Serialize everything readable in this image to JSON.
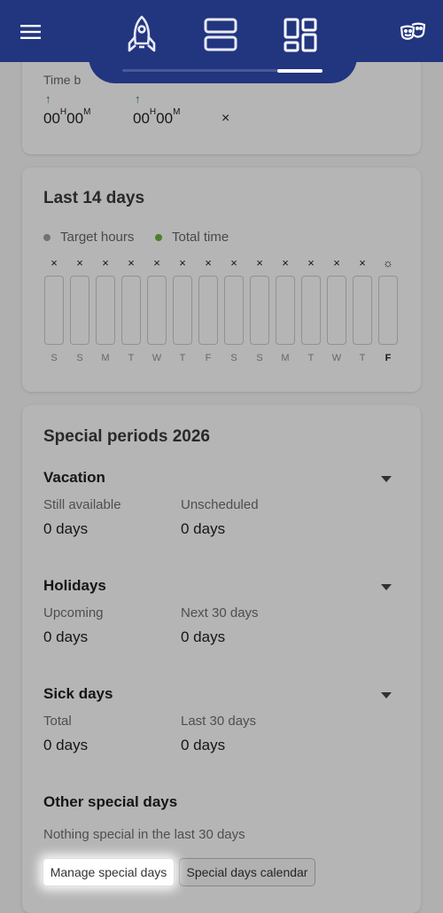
{
  "appbar": {
    "menu_icon": "hamburger-icon",
    "tabs": [
      {
        "icon": "rocket-icon",
        "active": false
      },
      {
        "icon": "two-rows-icon",
        "active": false
      },
      {
        "icon": "dashboard-icon",
        "active": true
      }
    ],
    "right_icon": "theater-masks-icon",
    "color": "#22357f"
  },
  "time_card": {
    "label": "Time b",
    "entries": [
      {
        "arrow": "↑",
        "hours": "00",
        "h_unit": "H",
        "minutes": "00",
        "m_unit": "M"
      },
      {
        "arrow": "↑",
        "hours": "00",
        "h_unit": "H",
        "minutes": "00",
        "m_unit": "M"
      }
    ],
    "close": "×"
  },
  "last14": {
    "title": "Last 14 days",
    "legend": [
      {
        "label": "Target hours",
        "color": "#9e9e9e"
      },
      {
        "label": "Total time",
        "color": "#6fae3c"
      }
    ],
    "days": [
      {
        "mark": "×",
        "letter": "S",
        "today": false
      },
      {
        "mark": "×",
        "letter": "S",
        "today": false
      },
      {
        "mark": "×",
        "letter": "M",
        "today": false
      },
      {
        "mark": "×",
        "letter": "T",
        "today": false
      },
      {
        "mark": "×",
        "letter": "W",
        "today": false
      },
      {
        "mark": "×",
        "letter": "T",
        "today": false
      },
      {
        "mark": "×",
        "letter": "F",
        "today": false
      },
      {
        "mark": "×",
        "letter": "S",
        "today": false
      },
      {
        "mark": "×",
        "letter": "S",
        "today": false
      },
      {
        "mark": "×",
        "letter": "M",
        "today": false
      },
      {
        "mark": "×",
        "letter": "T",
        "today": false
      },
      {
        "mark": "×",
        "letter": "W",
        "today": false
      },
      {
        "mark": "×",
        "letter": "T",
        "today": false
      },
      {
        "mark": "☼",
        "letter": "F",
        "today": true
      }
    ]
  },
  "special": {
    "title": "Special periods 2026",
    "vacation": {
      "title": "Vacation",
      "col1_label": "Still available",
      "col1_value": "0 days",
      "col2_label": "Unscheduled",
      "col2_value": "0 days"
    },
    "holidays": {
      "title": "Holidays",
      "col1_label": "Upcoming",
      "col1_value": "0 days",
      "col2_label": "Next 30 days",
      "col2_value": "0 days"
    },
    "sick": {
      "title": "Sick days",
      "col1_label": "Total",
      "col1_value": "0 days",
      "col2_label": "Last 30 days",
      "col2_value": "0 days"
    },
    "other": {
      "title": "Other special days",
      "note": "Nothing special in the last 30 days"
    },
    "buttons": {
      "manage": "Manage special days",
      "calendar": "Special days calendar"
    }
  }
}
